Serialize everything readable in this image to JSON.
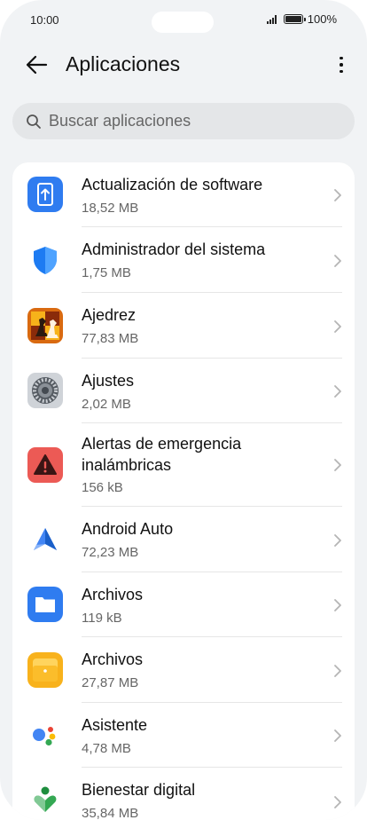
{
  "status_bar": {
    "time": "10:00",
    "battery": "100%"
  },
  "header": {
    "title": "Aplicaciones"
  },
  "search": {
    "placeholder": "Buscar aplicaciones"
  },
  "apps": [
    {
      "name": "Actualización de software",
      "size": "18,52 MB",
      "icon": "software-update-icon"
    },
    {
      "name": "Administrador del sistema",
      "size": "1,75 MB",
      "icon": "shield-icon"
    },
    {
      "name": "Ajedrez",
      "size": "77,83 MB",
      "icon": "chess-icon"
    },
    {
      "name": "Ajustes",
      "size": "2,02 MB",
      "icon": "gear-icon"
    },
    {
      "name": "Alertas de emergencia inalámbricas",
      "size": "156 kB",
      "icon": "warning-icon"
    },
    {
      "name": "Android Auto",
      "size": "72,23 MB",
      "icon": "android-auto-icon"
    },
    {
      "name": "Archivos",
      "size": "119 kB",
      "icon": "folder-icon"
    },
    {
      "name": "Archivos",
      "size": "27,87 MB",
      "icon": "files-icon"
    },
    {
      "name": "Asistente",
      "size": "4,78 MB",
      "icon": "assistant-icon"
    },
    {
      "name": "Bienestar digital",
      "size": "35,84 MB",
      "icon": "wellbeing-icon"
    }
  ]
}
